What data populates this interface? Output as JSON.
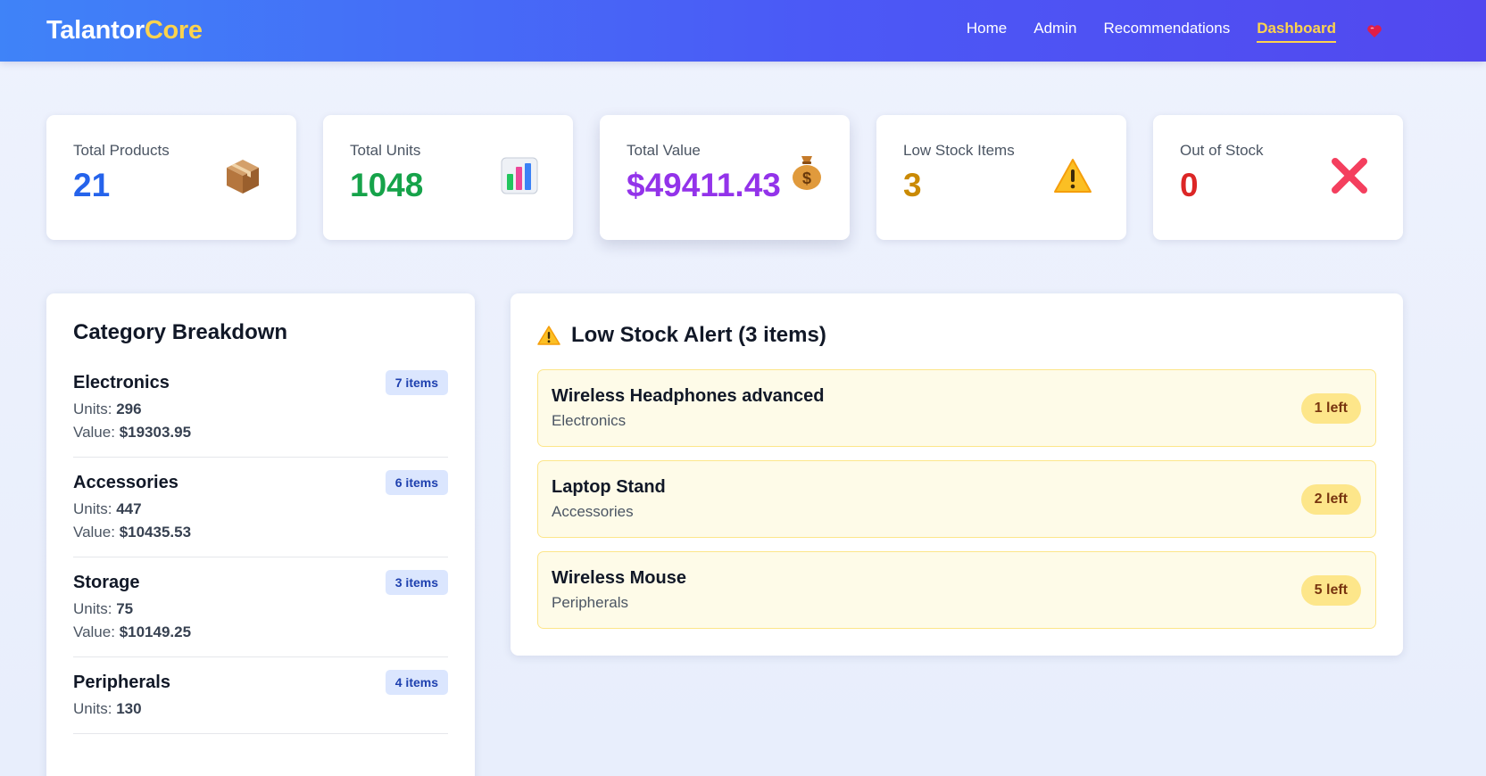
{
  "nav": {
    "brand_main": "Talantor",
    "brand_accent": "Core",
    "links": [
      "Home",
      "Admin",
      "Recommendations",
      "Dashboard"
    ],
    "active": "Dashboard",
    "heart_icon": "heart-icon"
  },
  "stats": [
    {
      "label": "Total Products",
      "value": "21",
      "color": "#2563eb",
      "icon": "package-icon"
    },
    {
      "label": "Total Units",
      "value": "1048",
      "color": "#16a34a",
      "icon": "bar-chart-icon"
    },
    {
      "label": "Total Value",
      "value": "$49411.43",
      "color": "#9333ea",
      "icon": "money-bag-icon"
    },
    {
      "label": "Low Stock Items",
      "value": "3",
      "color": "#ca8a04",
      "icon": "warning-icon"
    },
    {
      "label": "Out of Stock",
      "value": "0",
      "color": "#dc2626",
      "icon": "cross-mark-icon"
    }
  ],
  "categories": {
    "title": "Category Breakdown",
    "units_label": "Units:",
    "value_label": "Value:",
    "items": [
      {
        "name": "Electronics",
        "badge": "7 items",
        "units": "296",
        "value": "$19303.95"
      },
      {
        "name": "Accessories",
        "badge": "6 items",
        "units": "447",
        "value": "$10435.53"
      },
      {
        "name": "Storage",
        "badge": "3 items",
        "units": "75",
        "value": "$10149.25"
      },
      {
        "name": "Peripherals",
        "badge": "4 items",
        "units": "130",
        "value": ""
      }
    ]
  },
  "alerts": {
    "title": "Low Stock Alert (3 items)",
    "items": [
      {
        "name": "Wireless Headphones advanced",
        "category": "Electronics",
        "badge": "1 left"
      },
      {
        "name": "Laptop Stand",
        "category": "Accessories",
        "badge": "2 left"
      },
      {
        "name": "Wireless Mouse",
        "category": "Peripherals",
        "badge": "5 left"
      }
    ]
  }
}
